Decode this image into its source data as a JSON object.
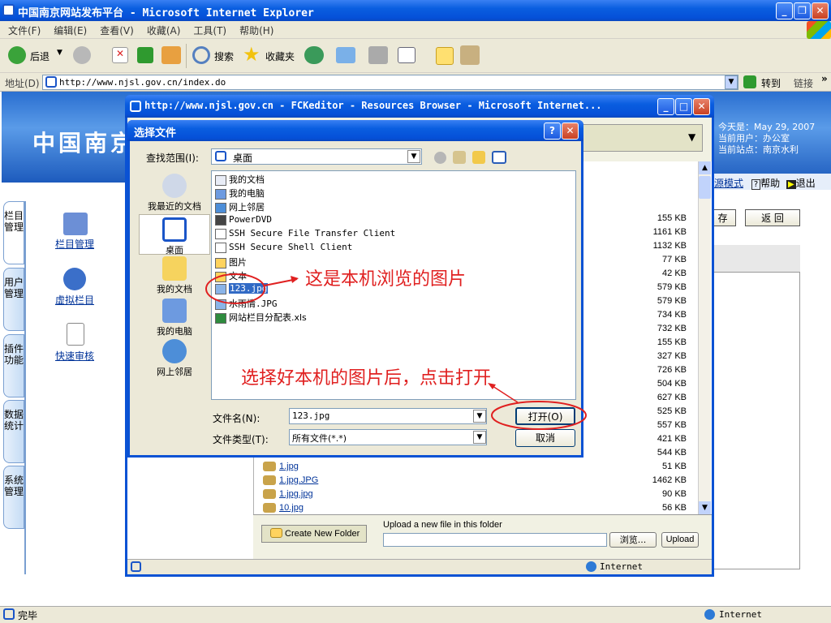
{
  "ie": {
    "title": "中国南京网站发布平台 - Microsoft Internet Explorer",
    "menu": [
      "文件(F)",
      "编辑(E)",
      "查看(V)",
      "收藏(A)",
      "工具(T)",
      "帮助(H)"
    ],
    "back": "后退",
    "search": "搜索",
    "favorites": "收藏夹",
    "address_label": "地址(D)",
    "address": "http://www.njsl.gov.cn/index.do",
    "go": "转到",
    "links": "链接",
    "status": "完毕",
    "zone": "Internet"
  },
  "page": {
    "logo": "中国南京",
    "date": "今天是：May 29, 2007",
    "user": "当前用户：办公室",
    "site": "当前站点：南京水利",
    "mode": "源模式",
    "help": "帮助",
    "exit": "退出",
    "tabs": [
      "栏目管理",
      "用户管理",
      "插件功能",
      "数据统计",
      "系统管理"
    ],
    "icons": [
      "栏目管理",
      "虚拟栏目",
      "快速审核"
    ],
    "save": "存",
    "back": "返 回"
  },
  "fck": {
    "title": "http://www.njsl.gov.cn - FCKeditor - Resources Browser - Microsoft Internet...",
    "sizes": [
      "155 KB",
      "1161 KB",
      "1132 KB",
      "77 KB",
      "42 KB",
      "579 KB",
      "579 KB",
      "734 KB",
      "732 KB",
      "155 KB",
      "327 KB",
      "726 KB",
      "504 KB",
      "627 KB",
      "525 KB",
      "557 KB",
      "421 KB",
      "544 KB",
      "51 KB",
      "1462 KB",
      "90 KB",
      "56 KB"
    ],
    "files": [
      {
        "name": "1.jpg"
      },
      {
        "name": "1.jpg.JPG"
      },
      {
        "name": "1.jpg.jpg"
      },
      {
        "name": "10.jpg"
      }
    ],
    "create_folder": "Create New Folder",
    "upload_label": "Upload a new file in this folder",
    "browse": "浏览...",
    "upload": "Upload",
    "zone": "Internet"
  },
  "dialog": {
    "title": "选择文件",
    "lookin_label": "查找范围(I):",
    "lookin": "桌面",
    "places": [
      "我最近的文档",
      "桌面",
      "我的文档",
      "我的电脑",
      "网上邻居"
    ],
    "items": [
      "我的文档",
      "我的电脑",
      "网上邻居",
      "PowerDVD",
      "SSH Secure File Transfer Client",
      "SSH Secure Shell Client",
      "图片",
      "文本",
      "123.jpg",
      "水雨情.JPG",
      "网站栏目分配表.xls"
    ],
    "filename_label": "文件名(N):",
    "filename": "123.jpg",
    "filetype_label": "文件类型(T):",
    "filetype": "所有文件(*.*)",
    "open": "打开(O)",
    "cancel": "取消"
  },
  "annotations": {
    "a1": "这是本机浏览的图片",
    "a2": "选择好本机的图片后，点击打开"
  },
  "colors": {
    "xp_blue": "#0a5ee0",
    "annotation_red": "#e02020",
    "dialog_bg": "#ece9d8"
  }
}
